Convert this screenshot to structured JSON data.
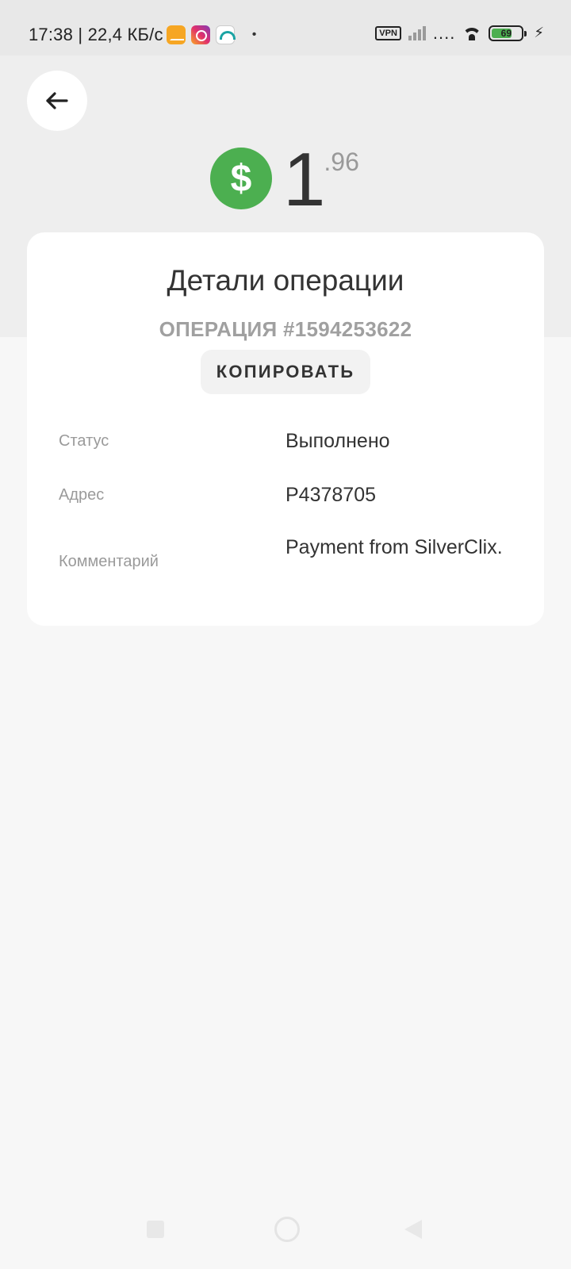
{
  "status_bar": {
    "time_speed": "17:38 | 22,4 КБ/с",
    "dot": "•",
    "vpn": "VPN",
    "dots": "....",
    "battery": "69",
    "bolt": "⚡"
  },
  "amount": {
    "currency_symbol": "$",
    "integer": "1",
    "fraction": ".96",
    "currency_color": "#4caf50"
  },
  "card": {
    "title": "Детали операции",
    "operation_id": "ОПЕРАЦИЯ #1594253622",
    "copy_label": "КОПИРОВАТЬ",
    "rows": [
      {
        "label": "Статус",
        "value": "Выполнено"
      },
      {
        "label": "Адрес",
        "value": "P4378705"
      },
      {
        "label": "Комментарий",
        "value": "Payment from SilverClix."
      }
    ]
  },
  "icons": {
    "back": "arrow-left-icon",
    "nav_recent": "square-icon",
    "nav_home": "circle-icon",
    "nav_back": "triangle-back-icon"
  }
}
